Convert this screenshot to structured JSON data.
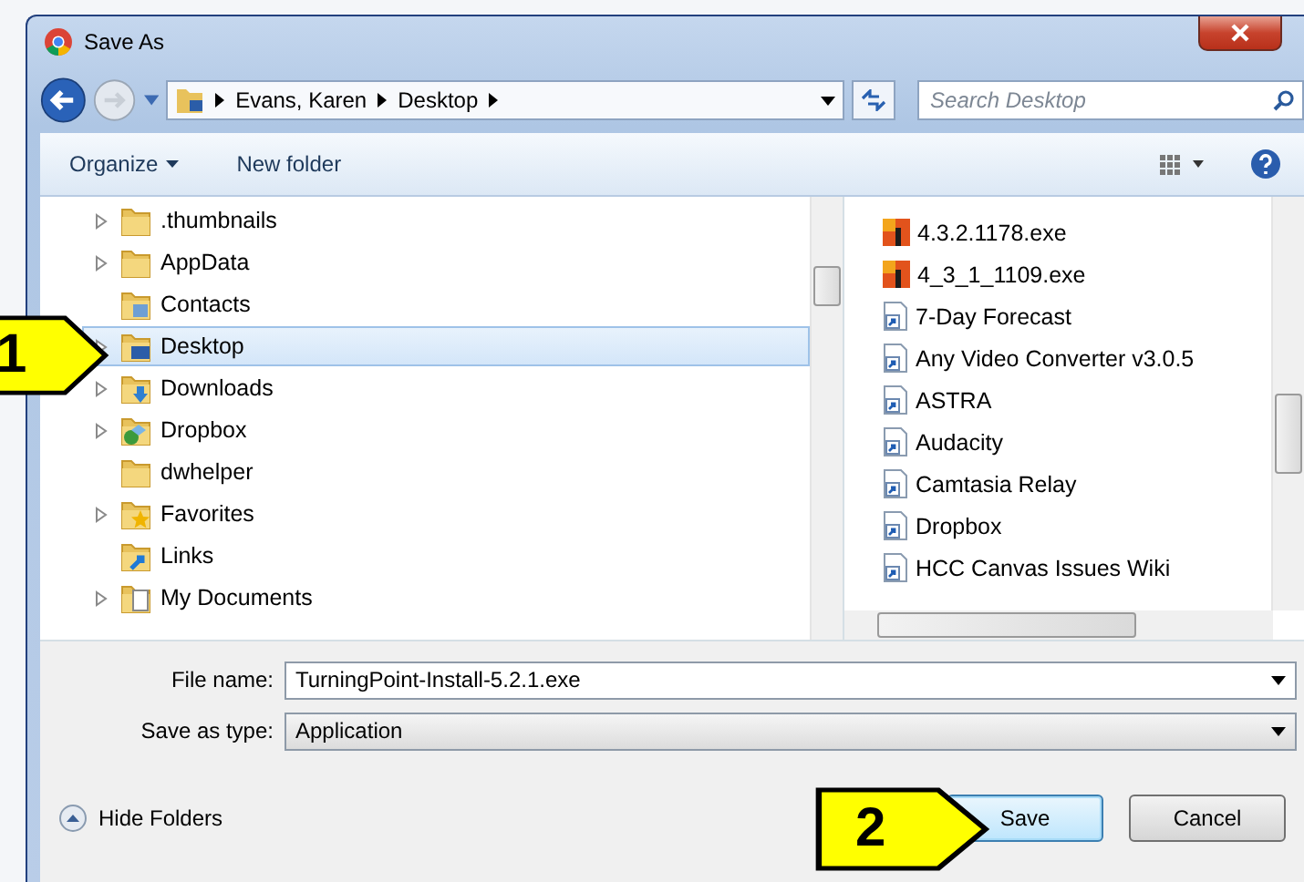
{
  "window": {
    "title": "Save As"
  },
  "address": {
    "crumbs": [
      "Evans, Karen",
      "Desktop"
    ]
  },
  "search": {
    "placeholder": "Search Desktop"
  },
  "toolbar": {
    "organize": "Organize",
    "new_folder": "New folder"
  },
  "tree": [
    {
      "label": ".thumbnails",
      "kind": "folder",
      "expandable": true,
      "selected": false
    },
    {
      "label": "AppData",
      "kind": "folder",
      "expandable": true,
      "selected": false
    },
    {
      "label": "Contacts",
      "kind": "contacts",
      "expandable": false,
      "selected": false
    },
    {
      "label": "Desktop",
      "kind": "desktop",
      "expandable": true,
      "selected": true
    },
    {
      "label": "Downloads",
      "kind": "downloads",
      "expandable": true,
      "selected": false
    },
    {
      "label": "Dropbox",
      "kind": "dropbox",
      "expandable": true,
      "selected": false
    },
    {
      "label": "dwhelper",
      "kind": "folder",
      "expandable": false,
      "selected": false
    },
    {
      "label": "Favorites",
      "kind": "favorites",
      "expandable": true,
      "selected": false
    },
    {
      "label": "Links",
      "kind": "links",
      "expandable": false,
      "selected": false
    },
    {
      "label": "My Documents",
      "kind": "documents",
      "expandable": true,
      "selected": false
    }
  ],
  "files": [
    {
      "name": "4.3.2.1178.exe",
      "kind": "exe"
    },
    {
      "name": "4_3_1_1109.exe",
      "kind": "exe"
    },
    {
      "name": "7-Day Forecast",
      "kind": "shortcut"
    },
    {
      "name": "Any Video Converter v3.0.5",
      "kind": "shortcut"
    },
    {
      "name": "ASTRA",
      "kind": "shortcut"
    },
    {
      "name": "Audacity",
      "kind": "shortcut"
    },
    {
      "name": "Camtasia Relay",
      "kind": "shortcut"
    },
    {
      "name": "Dropbox",
      "kind": "shortcut"
    },
    {
      "name": "HCC Canvas Issues Wiki",
      "kind": "shortcut"
    }
  ],
  "file_name": {
    "label": "File name:",
    "value": "TurningPoint-Install-5.2.1.exe"
  },
  "save_type": {
    "label": "Save as type:",
    "value": "Application"
  },
  "hide_folders": "Hide Folders",
  "buttons": [
    {
      "label": "Save",
      "default": true
    },
    {
      "label": "Cancel",
      "default": false
    }
  ],
  "callouts": [
    {
      "label": "1"
    },
    {
      "label": "2"
    }
  ]
}
